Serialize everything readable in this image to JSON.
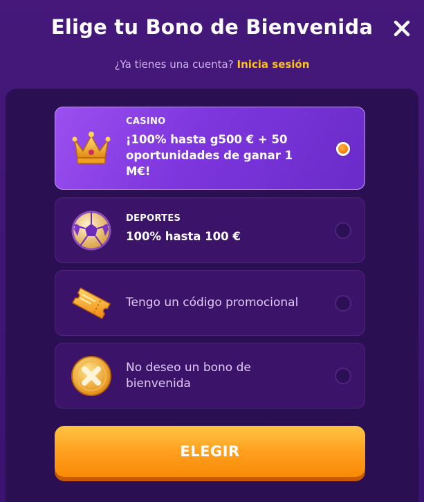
{
  "header": {
    "title": "Elige tu Bono de Bienvenida",
    "close_icon": "close-icon"
  },
  "login_prompt": {
    "text": "¿Ya tienes una cuenta?",
    "link_label": "Inicia sesión"
  },
  "options": [
    {
      "category": "CASINO",
      "title": "¡100% hasta g500 € + 50 oportunidades de ganar 1 M€!",
      "icon": "crown-icon",
      "selected": true
    },
    {
      "category": "DEPORTES",
      "title": "100% hasta 100 €",
      "icon": "soccer-ball-icon",
      "selected": false
    },
    {
      "category": "",
      "title": "Tengo un código promocional",
      "icon": "ticket-icon",
      "selected": false
    },
    {
      "category": "",
      "title": "No deseo un bono de bienvenida",
      "icon": "no-bonus-coin-icon",
      "selected": false
    }
  ],
  "submit": {
    "label": "ELEGIR"
  },
  "colors": {
    "background": "#3d1770",
    "accent": "#ffc21a",
    "selected_card": "#8a40e8",
    "button": "#ffa01e"
  }
}
